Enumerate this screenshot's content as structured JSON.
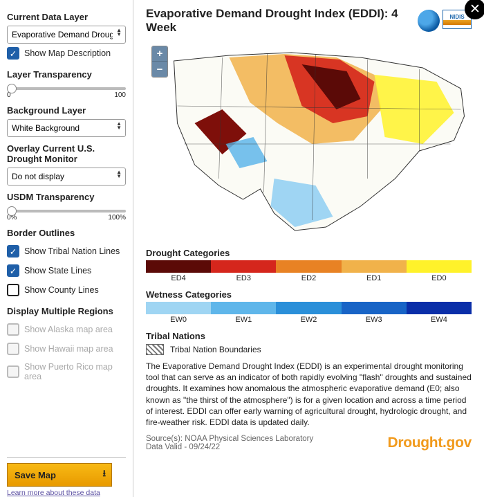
{
  "sidebar": {
    "currentDataLayer": {
      "label": "Current Data Layer",
      "value": "Evaporative Demand Droug"
    },
    "showMapDesc": {
      "label": "Show Map Description",
      "checked": true
    },
    "layerTransparency": {
      "label": "Layer Transparency",
      "min": "0",
      "max": "100",
      "value": 0
    },
    "backgroundLayer": {
      "label": "Background Layer",
      "value": "White Background"
    },
    "overlayUSDM": {
      "label": "Overlay Current U.S. Drought Monitor",
      "value": "Do not display"
    },
    "usdmTransparency": {
      "label": "USDM Transparency",
      "min": "0%",
      "max": "100%",
      "value": 0
    },
    "borderOutlines": {
      "label": "Border Outlines",
      "tribal": {
        "label": "Show Tribal Nation Lines",
        "checked": true
      },
      "state": {
        "label": "Show State Lines",
        "checked": true
      },
      "county": {
        "label": "Show County Lines",
        "checked": false
      }
    },
    "multiRegions": {
      "label": "Display Multiple Regions",
      "alaska": {
        "label": "Show Alaska map area"
      },
      "hawaii": {
        "label": "Show Hawaii map area"
      },
      "puertorico": {
        "label": "Show Puerto Rico map area"
      }
    },
    "saveBtn": "Save Map",
    "learnLink": "Learn more about these data"
  },
  "main": {
    "title": "Evaporative Demand Drought Index (EDDI): 4 Week",
    "logos": {
      "nidis": "NIDIS"
    },
    "droughtCategories": {
      "label": "Drought Categories",
      "colors": [
        "#5b0a07",
        "#d5261c",
        "#e88224",
        "#f1b24a",
        "#fff22a"
      ],
      "labels": [
        "ED4",
        "ED3",
        "ED2",
        "ED1",
        "ED0"
      ]
    },
    "wetnessCategories": {
      "label": "Wetness Categories",
      "colors": [
        "#9fd5f3",
        "#5fb6ea",
        "#2a8fd9",
        "#1864c6",
        "#0a2ea8"
      ],
      "labels": [
        "EW0",
        "EW1",
        "EW2",
        "EW3",
        "EW4"
      ]
    },
    "tribalNations": {
      "label": "Tribal Nations",
      "boundary": "Tribal Nation Boundaries"
    },
    "description": "The Evaporative Demand Drought Index (EDDI) is an experimental drought monitoring tool that can serve as an indicator of both rapidly evolving \"flash\" droughts and sustained droughts. It examines how anomalous the atmospheric evaporative demand (E0; also known as \"the thirst of the atmosphere\") is for a given location and across a time period of interest. EDDI can offer early warning of agricultural drought, hydrologic drought, and fire-weather risk. EDDI data is updated daily.",
    "source": "Source(s): NOAA Physical Sciences Laboratory",
    "valid": "Data Valid - 09/24/22",
    "brand": "Drought.gov"
  }
}
